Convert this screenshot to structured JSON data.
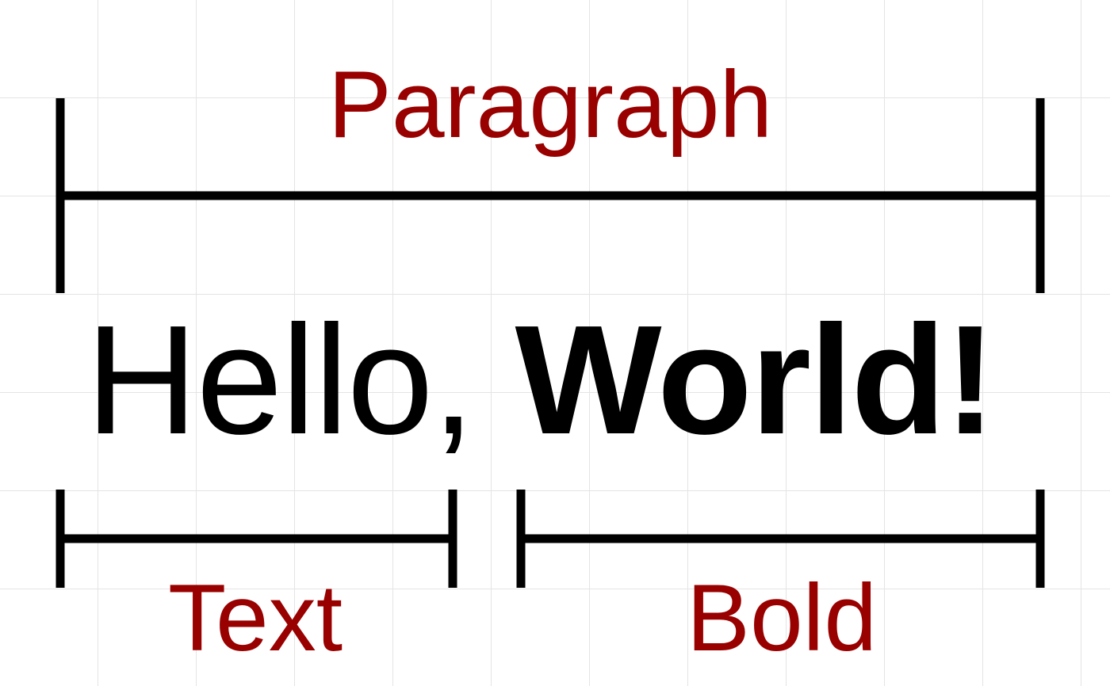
{
  "labels": {
    "paragraph": "Paragraph",
    "text": "Text",
    "bold": "Bold"
  },
  "sentence": {
    "plain": "Hello, ",
    "bold": "World!"
  },
  "colors": {
    "label": "#990000",
    "ink": "#000000",
    "grid": "#e4e4e4",
    "background": "#ffffff"
  }
}
